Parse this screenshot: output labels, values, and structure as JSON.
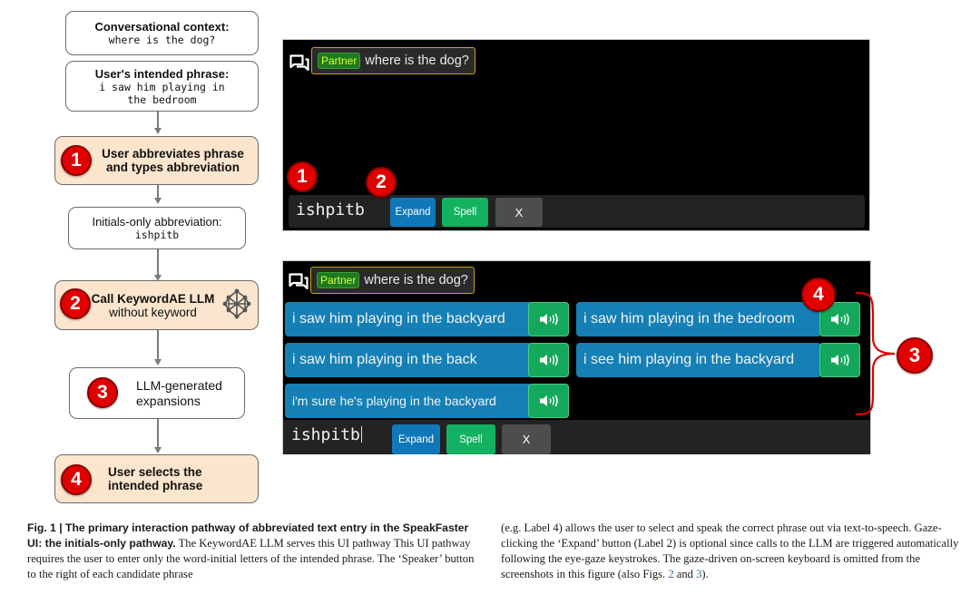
{
  "flowchart": {
    "context_box": {
      "title": "Conversational context:",
      "value": "where is the dog?"
    },
    "intended_box": {
      "title": "User's intended phrase:",
      "value_line1": "i saw him playing in",
      "value_line2": "the bedroom"
    },
    "step1": {
      "number": "1",
      "line1": "User abbreviates phrase",
      "line2": "and types abbreviation"
    },
    "abbr_box": {
      "title": "Initials-only abbreviation:",
      "value": "ishpitb"
    },
    "step2": {
      "number": "2",
      "line1": "Call KeywordAE LLM",
      "line2": "without keyword",
      "icon": "neural-network-icon"
    },
    "step3": {
      "number": "3",
      "line1": "LLM-generated",
      "line2": "expansions"
    },
    "step4": {
      "number": "4",
      "line1": "User selects the",
      "line2": "intended phrase"
    }
  },
  "panel_top": {
    "chat_icon": "chat-bubbles-icon",
    "partner_tag": "Partner",
    "partner_message": "where is the dog?",
    "abbreviation": "ishpitb",
    "buttons": {
      "expand": "Expand",
      "spell": "Spell",
      "clear": "X"
    },
    "badge_input": "1",
    "badge_expand": "2"
  },
  "panel_bottom": {
    "chat_icon": "chat-bubbles-icon",
    "partner_tag": "Partner",
    "partner_message": "where is the dog?",
    "candidates": [
      "i saw him playing in the backyard",
      "i saw him playing in the bedroom",
      "i saw him playing in the back",
      "i see him playing in the backyard",
      "i'm sure he's playing in the backyard"
    ],
    "speaker_icon": "speaker-icon",
    "abbreviation": "ishpitb",
    "buttons": {
      "expand": "Expand",
      "spell": "Spell",
      "clear": "X"
    },
    "badge_select": "4",
    "badge_expansions": "3"
  },
  "caption": {
    "bold": "Fig. 1 | The primary interaction pathway of abbreviated text entry in the SpeakFaster UI: the initials-only pathway.",
    "left_body": " The KeywordAE LLM serves this UI pathway This UI pathway requires the user to enter only the word-initial letters of the intended phrase. The ‘Speaker’ button to the right of each candidate phrase",
    "right_body": "(e.g. Label 4) allows the user to select and speak the correct phrase out via text-to-speech. Gaze-clicking the ‘Expand’ button (Label 2) is optional since calls to the LLM are triggered automatically following the eye-gaze keystrokes. The gaze-driven on-screen keyboard is omitted from the screenshots in this figure (also Figs. ",
    "fig_ref_1": "2",
    "and_text": " and ",
    "fig_ref_2": "3",
    "end_text": ")."
  },
  "colors": {
    "badge_red": "#e00000",
    "peach": "#fbe5cd",
    "candidate_blue": "#1580b5",
    "speaker_green": "#14a85c",
    "partner_border": "#c7a21c"
  }
}
